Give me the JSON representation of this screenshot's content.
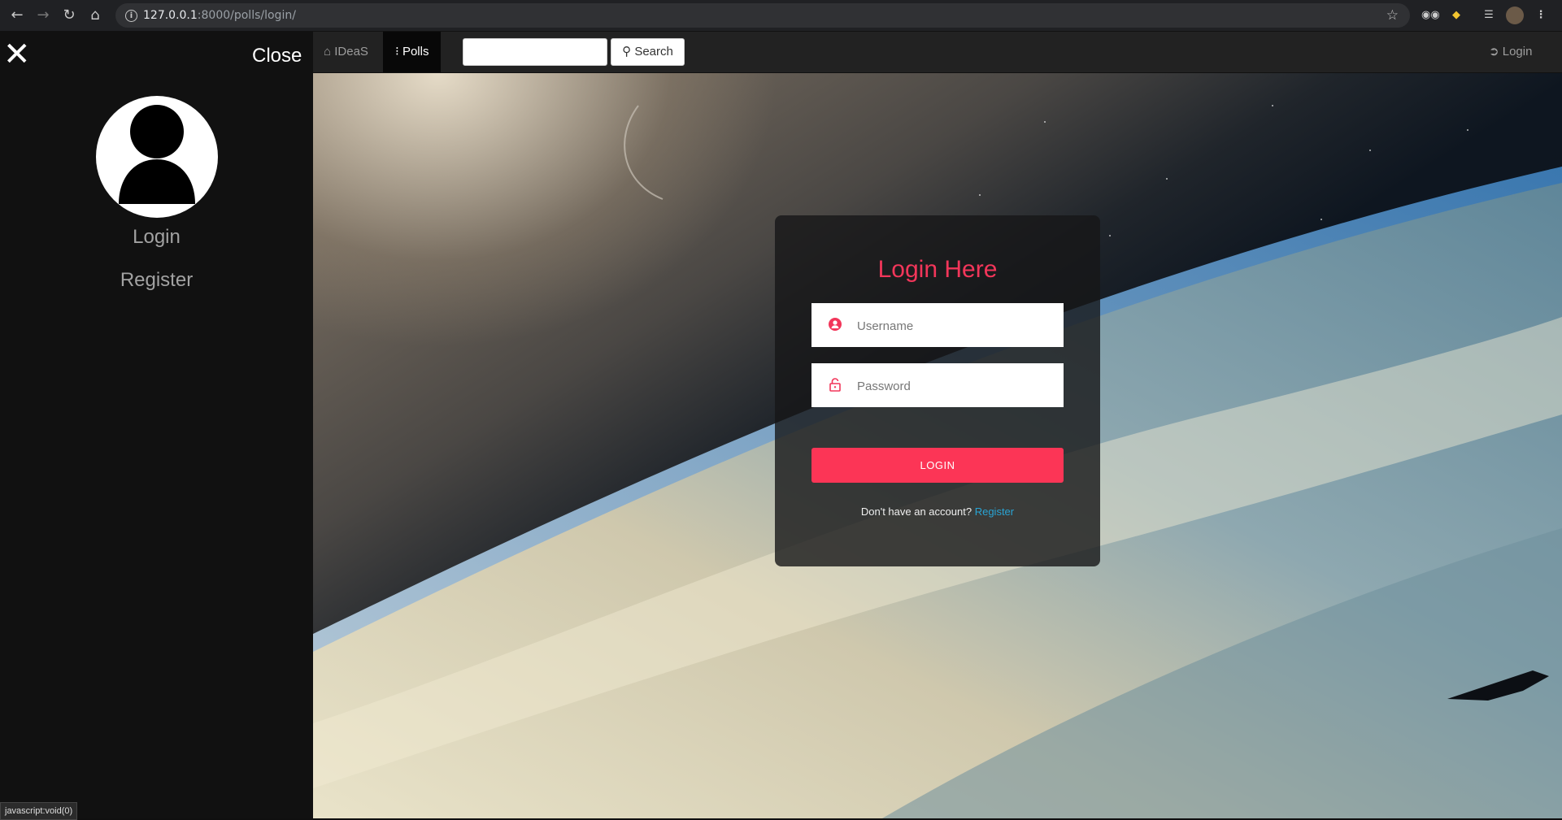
{
  "browser": {
    "url_host": "127.0.0.1",
    "url_rest": ":8000/polls/login/",
    "status_tip": "javascript:void(0)"
  },
  "sidebar": {
    "close_label": "Close",
    "links": [
      "Login",
      "Register"
    ]
  },
  "navbar": {
    "brand": "IDeaS",
    "polls": "Polls",
    "search_button": "Search",
    "search_value": "",
    "login": "Login"
  },
  "login_card": {
    "title": "Login Here",
    "username_placeholder": "Username",
    "password_placeholder": "Password",
    "submit_label": "LOGIN",
    "signup_prompt": "Don't have an account?",
    "signup_link": "Register"
  },
  "colors": {
    "accent": "#fc3556",
    "title": "#f2365a",
    "link": "#29a4d4",
    "sidebar_bg": "#111111",
    "navbar_bg": "#222222"
  }
}
